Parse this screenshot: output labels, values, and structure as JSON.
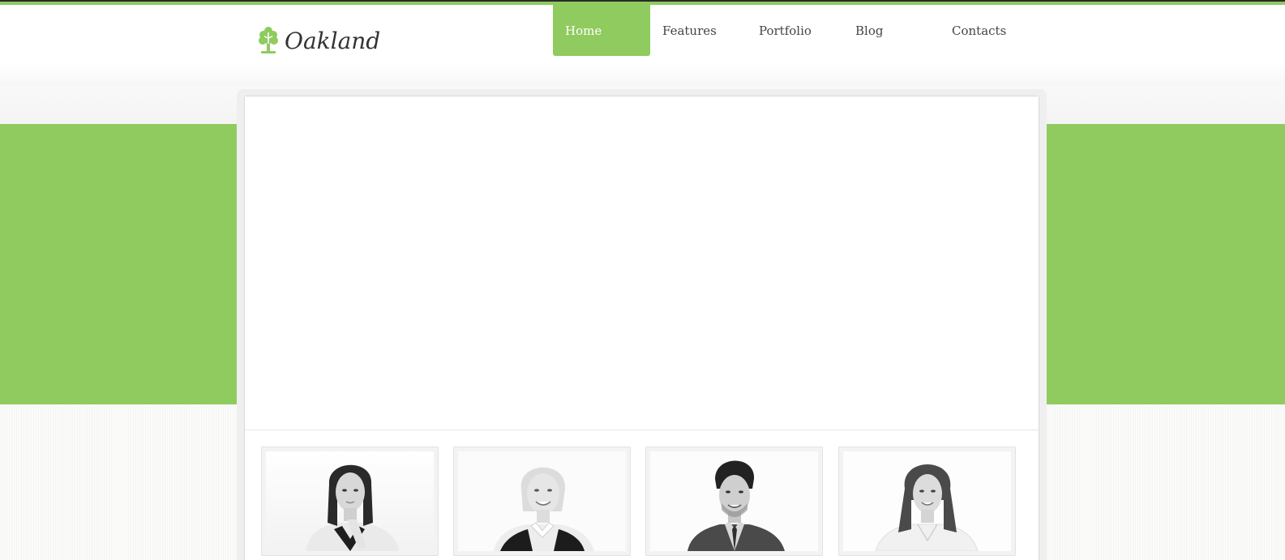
{
  "site": {
    "logo_text": "Oakland",
    "brand_color": "#8fcb5e",
    "logo_icon": "tree-icon"
  },
  "nav": {
    "items": [
      {
        "label": "Home",
        "active": true
      },
      {
        "label": "Features",
        "active": false
      },
      {
        "label": "Portfolio",
        "active": false
      },
      {
        "label": "Blog",
        "active": false
      },
      {
        "label": "Contacts",
        "active": false
      }
    ]
  },
  "team": {
    "members": [
      {
        "photo": "woman-dark-hair-portrait"
      },
      {
        "photo": "woman-blonde-portrait"
      },
      {
        "photo": "man-suit-portrait"
      },
      {
        "photo": "woman-long-hair-portrait"
      }
    ]
  }
}
